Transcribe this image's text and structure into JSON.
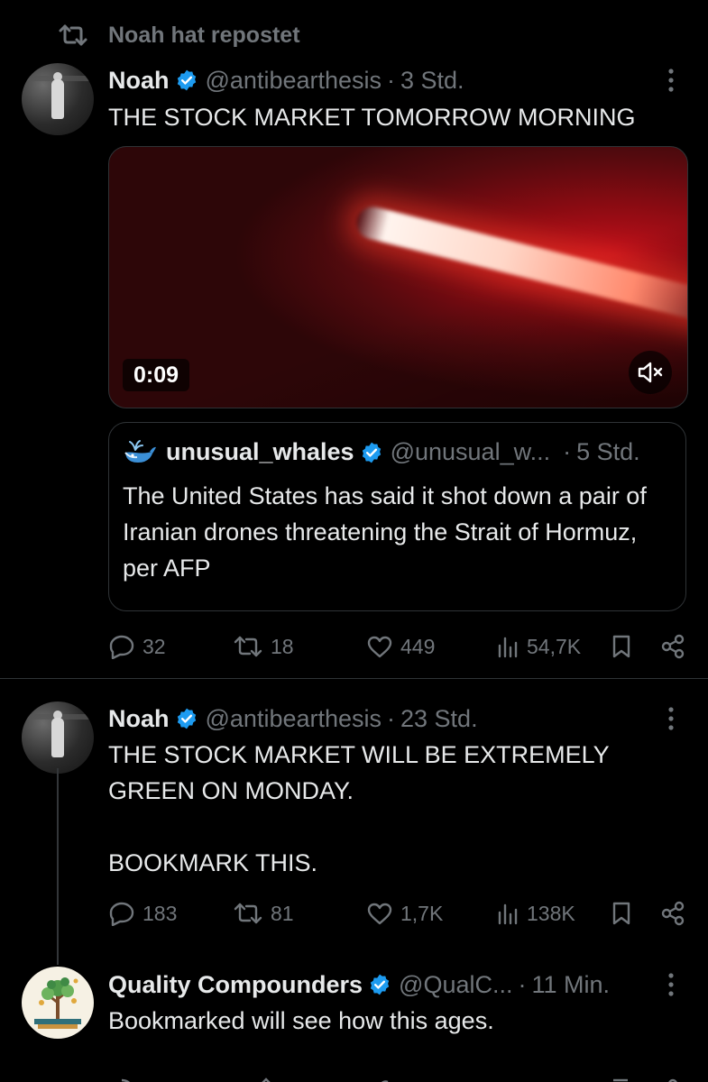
{
  "repost": {
    "label": "Noah hat repostet"
  },
  "tweets": [
    {
      "name": "Noah",
      "handle": "@antibearthesis",
      "time": "3 Std.",
      "text": "THE STOCK MARKET TOMORROW MORNING",
      "media": {
        "duration": "0:09"
      },
      "quote": {
        "name": "unusual_whales",
        "handle": "@unusual_w...",
        "time": "5 Std.",
        "text": "The United States has said it shot down a pair of Iranian drones threatening the Strait of Hormuz, per AFP"
      },
      "stats": {
        "replies": "32",
        "reposts": "18",
        "likes": "449",
        "views": "54,7K"
      }
    },
    {
      "name": "Noah",
      "handle": "@antibearthesis",
      "time": "23 Std.",
      "text": "THE STOCK MARKET WILL BE EXTREMELY GREEN ON MONDAY.\n\nBOOKMARK THIS.",
      "stats": {
        "replies": "183",
        "reposts": "81",
        "likes": "1,7K",
        "views": "138K"
      }
    },
    {
      "name": "Quality Compounders",
      "handle": "@QualC...",
      "time": "11 Min.",
      "text": "Bookmarked will see how this ages."
    }
  ],
  "colors": {
    "background": "#000000",
    "text": "#e7e9ea",
    "muted": "#71767b",
    "verified": "#1d9bf0",
    "border": "#2f3336"
  }
}
